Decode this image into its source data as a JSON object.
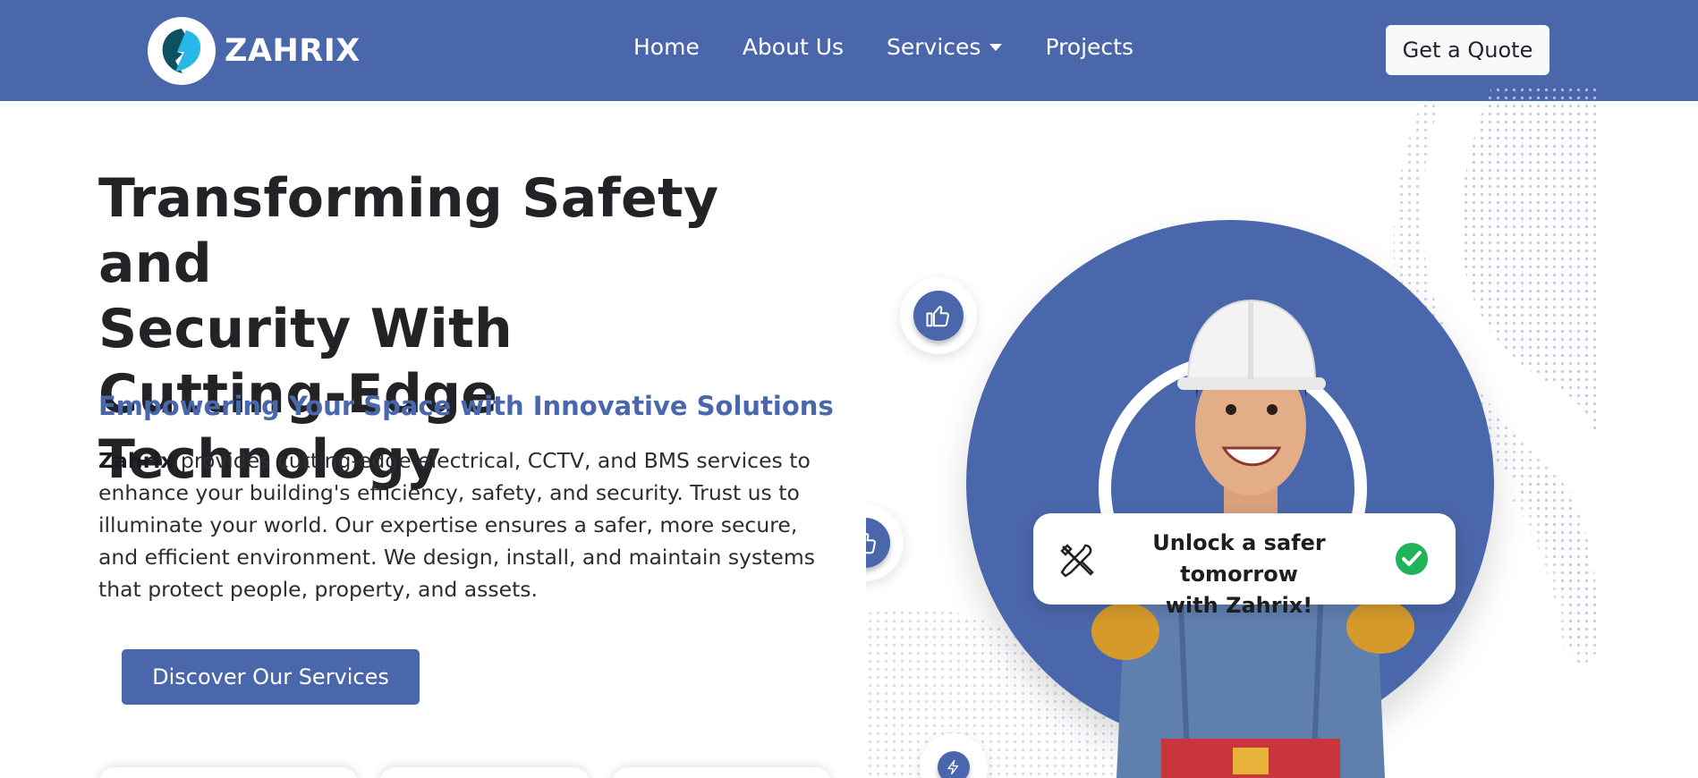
{
  "navbar": {
    "brand_name": "ZAHRIX",
    "logo_icon": "lightning-bolt-icon",
    "links": [
      {
        "label": "Home"
      },
      {
        "label": "About Us"
      },
      {
        "label": "Services"
      },
      {
        "label": "Projects"
      }
    ],
    "cta_label": "Get a Quote"
  },
  "hero": {
    "title_line1": "Transforming Safety and",
    "title_line2": "Security With",
    "title_line3": "Cutting-Edge Technology",
    "subtitle": "Empowering Your Space with Innovative Solutions",
    "description_brand": "Zahrix",
    "description_rest": " provides cutting-edge electrical, CCTV, and BMS services to enhance your building's efficiency, safety, and security. Trust us to illuminate your world. Our expertise ensures a safer, more secure, and efficient environment. We design, install, and maintain systems that protect people, property, and assets.",
    "button_label": "Discover Our Services"
  },
  "visual": {
    "promo_line1": "Unlock a safer tomorrow",
    "promo_line2": "with Zahrix!",
    "promo_left_icon": "tools-icon",
    "promo_right_icon": "check-circle-icon",
    "bubble_icons": [
      "thumbs-up-icon",
      "thumbs-up-icon",
      "lightning-bolt-icon"
    ]
  },
  "colors": {
    "primary": "#4b67ab",
    "navbar_text": "#ffffff",
    "heading": "#222326",
    "check_green": "#20b35a"
  }
}
